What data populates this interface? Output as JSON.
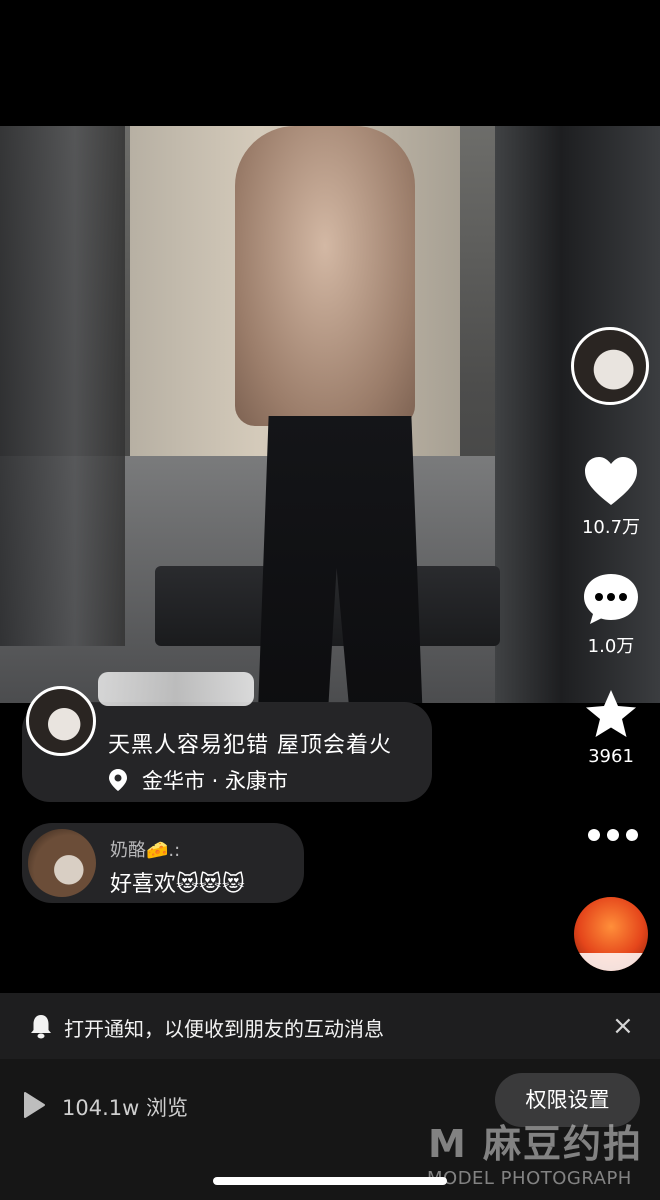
{
  "post": {
    "caption": "天黑人容易犯错 屋顶会着火",
    "location": "金华市 · 永康市"
  },
  "actions": {
    "likes": "10.7万",
    "comments": "1.0万",
    "favorites": "3961"
  },
  "comment": {
    "user": "奶酪🧀.:",
    "text": "好喜欢😻😻😻"
  },
  "notification": {
    "text": "打开通知，以便收到朋友的互动消息",
    "close": "×"
  },
  "footer": {
    "views": "104.1w 浏览",
    "permission_button": "权限设置"
  },
  "watermark": {
    "title": "M 麻豆约拍",
    "subtitle": "MODEL PHOTOGRAPH"
  },
  "colors": {
    "background": "#000000",
    "bubble": "#28282a",
    "notify_bg": "#1e1e1f"
  }
}
